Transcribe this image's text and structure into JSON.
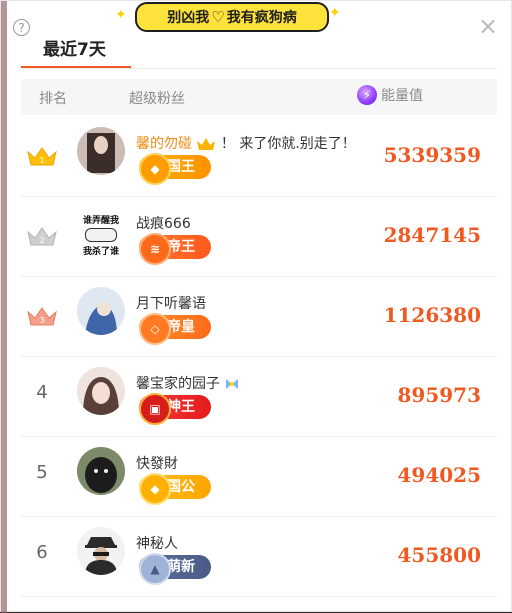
{
  "banner": {
    "left": "别凶我",
    "right": "我有疯狗病"
  },
  "tab": {
    "label": "最近7天"
  },
  "headers": {
    "rank": "排名",
    "fans": "超级粉丝",
    "energy": "能量值"
  },
  "rows": [
    {
      "rank": "1",
      "name": "馨的勿碰",
      "name_suffix": "！ 来了你就.别走了！",
      "name_color": "#f08c13",
      "badge": "国王",
      "badge_colors": [
        "#ffb400",
        "#ff9000"
      ],
      "value": "5339359"
    },
    {
      "rank": "2",
      "name": "战痕666",
      "badge": "帝王",
      "badge_colors": [
        "#ff7a2a",
        "#ff5a1f"
      ],
      "value": "2847145"
    },
    {
      "rank": "3",
      "name": "月下听馨语",
      "badge": "帝皇",
      "badge_colors": [
        "#ff8f2a",
        "#ff6a1a"
      ],
      "value": "1126380"
    },
    {
      "rank": "4",
      "name": "馨宝家的园子",
      "badge": "神王",
      "badge_colors": [
        "#ff3b3b",
        "#e21c1c"
      ],
      "value": "895973"
    },
    {
      "rank": "5",
      "name": "快發財",
      "badge": "国公",
      "badge_colors": [
        "#ffc21a",
        "#ffa400"
      ],
      "value": "494025"
    },
    {
      "rank": "6",
      "name": "神秘人",
      "badge": "萌新",
      "badge_colors": [
        "#5d6f9e",
        "#4a5b86"
      ],
      "value": "455800"
    }
  ],
  "avatar2_text": [
    "谁弄醒我",
    "我杀了谁"
  ]
}
